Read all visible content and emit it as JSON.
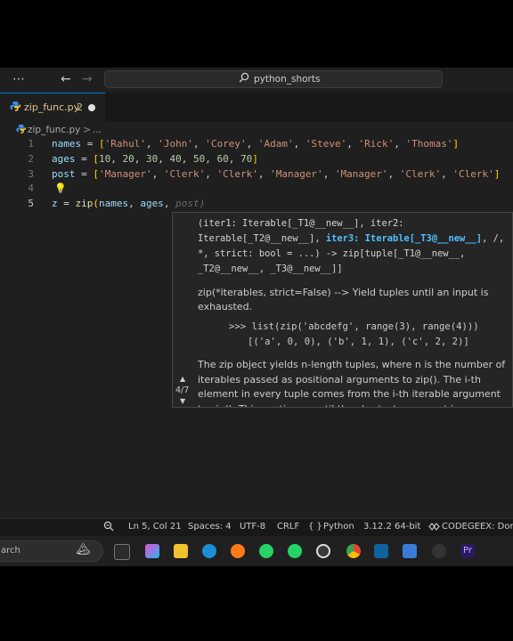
{
  "titlebar": {
    "menu_icon": "ellipsis-icon",
    "search_text": "python_shorts"
  },
  "tabs": [
    {
      "label": "zip_func.py",
      "problems": "2",
      "dirty": true
    }
  ],
  "breadcrumb": {
    "file": "zip_func.py",
    "separator": ">",
    "more": "..."
  },
  "editor": {
    "line_numbers": [
      "1",
      "2",
      "3",
      "4",
      "5"
    ],
    "lines": [
      "names = ['Rahul', 'John', 'Corey', 'Adam', 'Steve', 'Rick', 'Thomas']",
      "ages = [10, 20, 30, 40, 50, 60, 70]",
      "post = ['Manager', 'Clerk', 'Clerk', 'Manager', 'Manager', 'Clerk', 'Clerk']",
      "",
      "z = zip(names, ages, "
    ],
    "inlay_hint": "post)"
  },
  "hover": {
    "sig_part1": "(iter1: Iterable[_T1@__new__], iter2: Iterable[_T2@__new__], ",
    "sig_active": "iter3: Iterable[_T3@__new__]",
    "sig_part2": ", /, *, strict: bool = ...) -> zip[tuple[_T1@__new__, _T2@__new__, _T3@__new__]]",
    "doc_line": "zip(*iterables, strict=False) --> Yield tuples until an input is exhausted.",
    "example_input": ">>> list(zip('abcdefg', range(3), range(4)))",
    "example_output": "[('a', 0, 0), ('b', 1, 1), ('c', 2, 2)]",
    "doc_paragraph": "The zip object yields n-length tuples, where n is the number of iterables passed as positional arguments to zip(). The i-th element in every tuple comes from the i-th iterable argument to zip(). This continues until the shortest argument is exhausted.",
    "signature_count": "4/7"
  },
  "statusbar": {
    "position": "Ln 5, Col 21",
    "spaces": "Spaces: 4",
    "encoding": "UTF-8",
    "eol": "CRLF",
    "language_icon": "{ }",
    "language": "Python",
    "interpreter": "3.12.2 64-bit",
    "extension": "CODEGEEX: Done"
  },
  "taskbar": {
    "search_text": "arch"
  },
  "colors": {
    "accent": "#0078d4",
    "modified_tab": "#e2c08d",
    "editor_bg": "#1f1f1f"
  }
}
